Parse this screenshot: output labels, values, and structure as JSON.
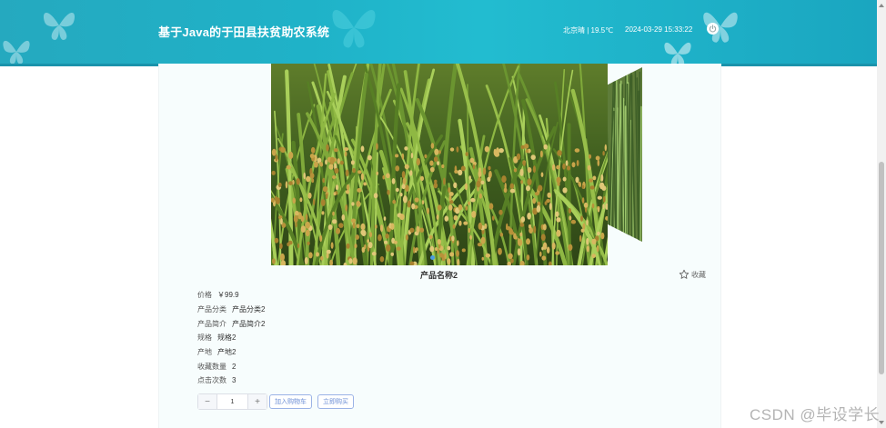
{
  "header": {
    "title": "基于Java的于田县扶贫助农系统",
    "weather": "北京晴 | 19.5℃",
    "datetime": "2024-03-29   15:33:22",
    "colors": {
      "bar": "#22b3c8",
      "accent": "#1a93ab"
    }
  },
  "product": {
    "name": "产品名称2",
    "favorite_label": "收藏",
    "attributes": [
      {
        "label": "价格",
        "value": "￥99.9"
      },
      {
        "label": "产品分类",
        "value": "产品分类2"
      },
      {
        "label": "产品简介",
        "value": "产品简介2"
      },
      {
        "label": "规格",
        "value": "规格2"
      },
      {
        "label": "产地",
        "value": "产地2"
      },
      {
        "label": "收藏数量",
        "value": "2"
      },
      {
        "label": "点击次数",
        "value": "3"
      }
    ]
  },
  "quantity": {
    "minus": "−",
    "value": "1",
    "plus": "+"
  },
  "actions": {
    "add_to_cart": "加入购物车",
    "buy_now": "立即购买"
  },
  "watermark": "CSDN @毕设学长",
  "icons": [
    "butterfly-icon",
    "power-icon",
    "star-icon"
  ]
}
